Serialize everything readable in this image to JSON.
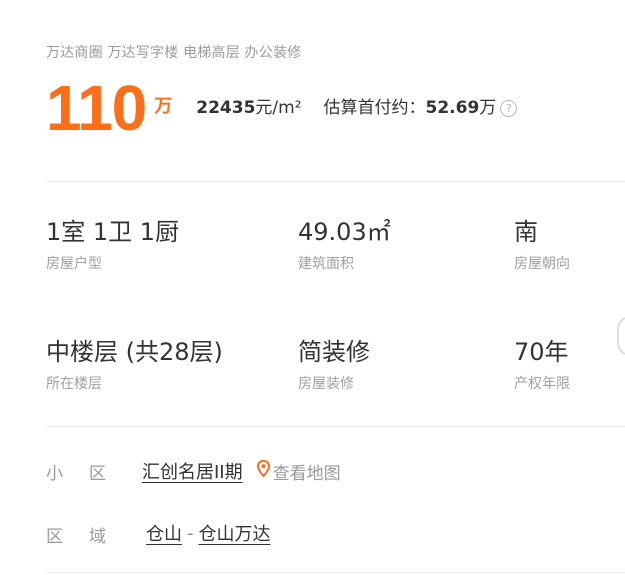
{
  "tags": "万达商圈 万达写字楼 电梯高层 办公装修",
  "price": {
    "total": "110",
    "total_unit": "万",
    "unit_price_value": "22435",
    "unit_price_suffix": "元/m²",
    "down_payment_label": "估算首付约：",
    "down_payment_value": "52.69",
    "down_payment_unit": "万",
    "help_icon": "question-circle-icon"
  },
  "attributes": [
    {
      "value": "1室 1卫 1厨",
      "label": "房屋户型"
    },
    {
      "value": "49.03㎡",
      "label": "建筑面积"
    },
    {
      "value": "南",
      "label": "房屋朝向"
    },
    {
      "value": "中楼层 (共28层)",
      "label": "所在楼层"
    },
    {
      "value": "简装修",
      "label": "房屋装修"
    },
    {
      "value": "70年",
      "label": "产权年限"
    }
  ],
  "community": {
    "label": "小区",
    "name": "汇创名居II期",
    "map_link": "查看地图",
    "map_icon": "location-pin-icon"
  },
  "region": {
    "label": "区域",
    "district": "仓山",
    "separator": "-",
    "area": "仓山万达"
  },
  "colors": {
    "accent": "#fe6d18",
    "muted": "#9a9a9a",
    "text": "#333333",
    "divider": "#ececec"
  }
}
